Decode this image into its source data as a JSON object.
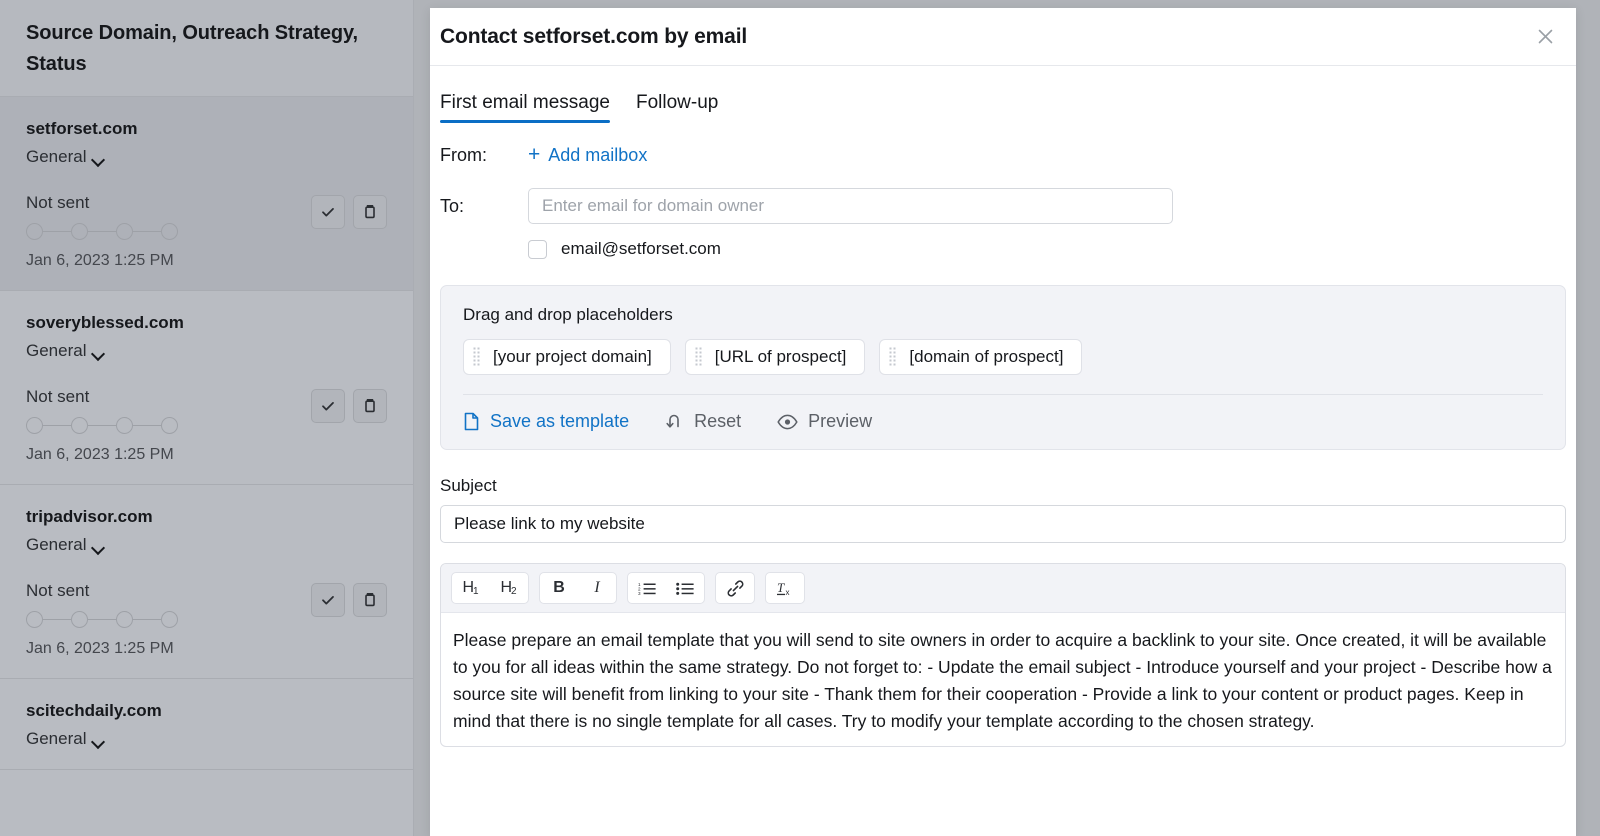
{
  "sidebar": {
    "header_title": "Source Domain, Outreach Strategy, Status",
    "rows": [
      {
        "domain": "setforset.com",
        "strategy": "General",
        "status": "Not sent",
        "timestamp": "Jan 6, 2023 1:25 PM",
        "selected": true
      },
      {
        "domain": "soveryblessed.com",
        "strategy": "General",
        "status": "Not sent",
        "timestamp": "Jan 6, 2023 1:25 PM",
        "selected": false
      },
      {
        "domain": "tripadvisor.com",
        "strategy": "General",
        "status": "Not sent",
        "timestamp": "Jan 6, 2023 1:25 PM",
        "selected": false
      },
      {
        "domain": "scitechdaily.com",
        "strategy": "General",
        "status": "",
        "timestamp": "",
        "selected": false
      }
    ],
    "row_action_check": "check-icon",
    "row_action_delete": "trash-icon"
  },
  "modal": {
    "title": "Contact setforset.com by email",
    "close_label": "✕",
    "tabs": [
      {
        "label": "First email message",
        "active": true
      },
      {
        "label": "Follow-up",
        "active": false
      }
    ],
    "from": {
      "label": "From:",
      "add_mailbox_label": "Add mailbox",
      "plus": "+"
    },
    "to": {
      "label": "To:",
      "placeholder": "Enter email for domain owner",
      "value": "",
      "suggestion": "email@setforset.com",
      "suggestion_checked": false
    },
    "placeholders_panel": {
      "title": "Drag and drop placeholders",
      "chips": [
        "[your project domain]",
        "[URL of prospect]",
        "[domain of prospect]"
      ],
      "actions": [
        {
          "label": "Save as template",
          "icon": "document-icon",
          "style": "primary"
        },
        {
          "label": "Reset",
          "icon": "undo-icon",
          "style": "muted"
        },
        {
          "label": "Preview",
          "icon": "eye-icon",
          "style": "muted"
        }
      ]
    },
    "subject": {
      "label": "Subject",
      "value": "Please link to my website"
    },
    "editor": {
      "toolbar_groups": [
        [
          {
            "name": "heading-1-button",
            "label": "H",
            "sub": "1"
          },
          {
            "name": "heading-2-button",
            "label": "H",
            "sub": "2"
          }
        ],
        [
          {
            "name": "bold-button",
            "label": "B",
            "sub": ""
          },
          {
            "name": "italic-button",
            "label": "I",
            "sub": ""
          }
        ],
        [
          {
            "name": "ordered-list-button",
            "label": "",
            "sub": ""
          },
          {
            "name": "bullet-list-button",
            "label": "",
            "sub": ""
          }
        ],
        [
          {
            "name": "link-button",
            "label": "",
            "sub": ""
          }
        ],
        [
          {
            "name": "clear-formatting-button",
            "label": "",
            "sub": ""
          }
        ]
      ],
      "body": "Please prepare an email template that you will send to site owners in order to acquire a backlink to your site. Once created, it will be available to you for all ideas within the same strategy. Do not forget to: - Update the email subject - Introduce yourself and your project - Describe how a source site will benefit from linking to your site - Thank them for their cooperation - Provide a link to your content or product pages. Keep in mind that there is no single template for all cases. Try to modify your template according to the chosen strategy."
    }
  },
  "colors": {
    "accent_blue": "#1273c6",
    "tab_underline": "#0b6ec5",
    "overlay_gray": "#b0b3b8",
    "panel_gray": "#f2f3f7"
  }
}
